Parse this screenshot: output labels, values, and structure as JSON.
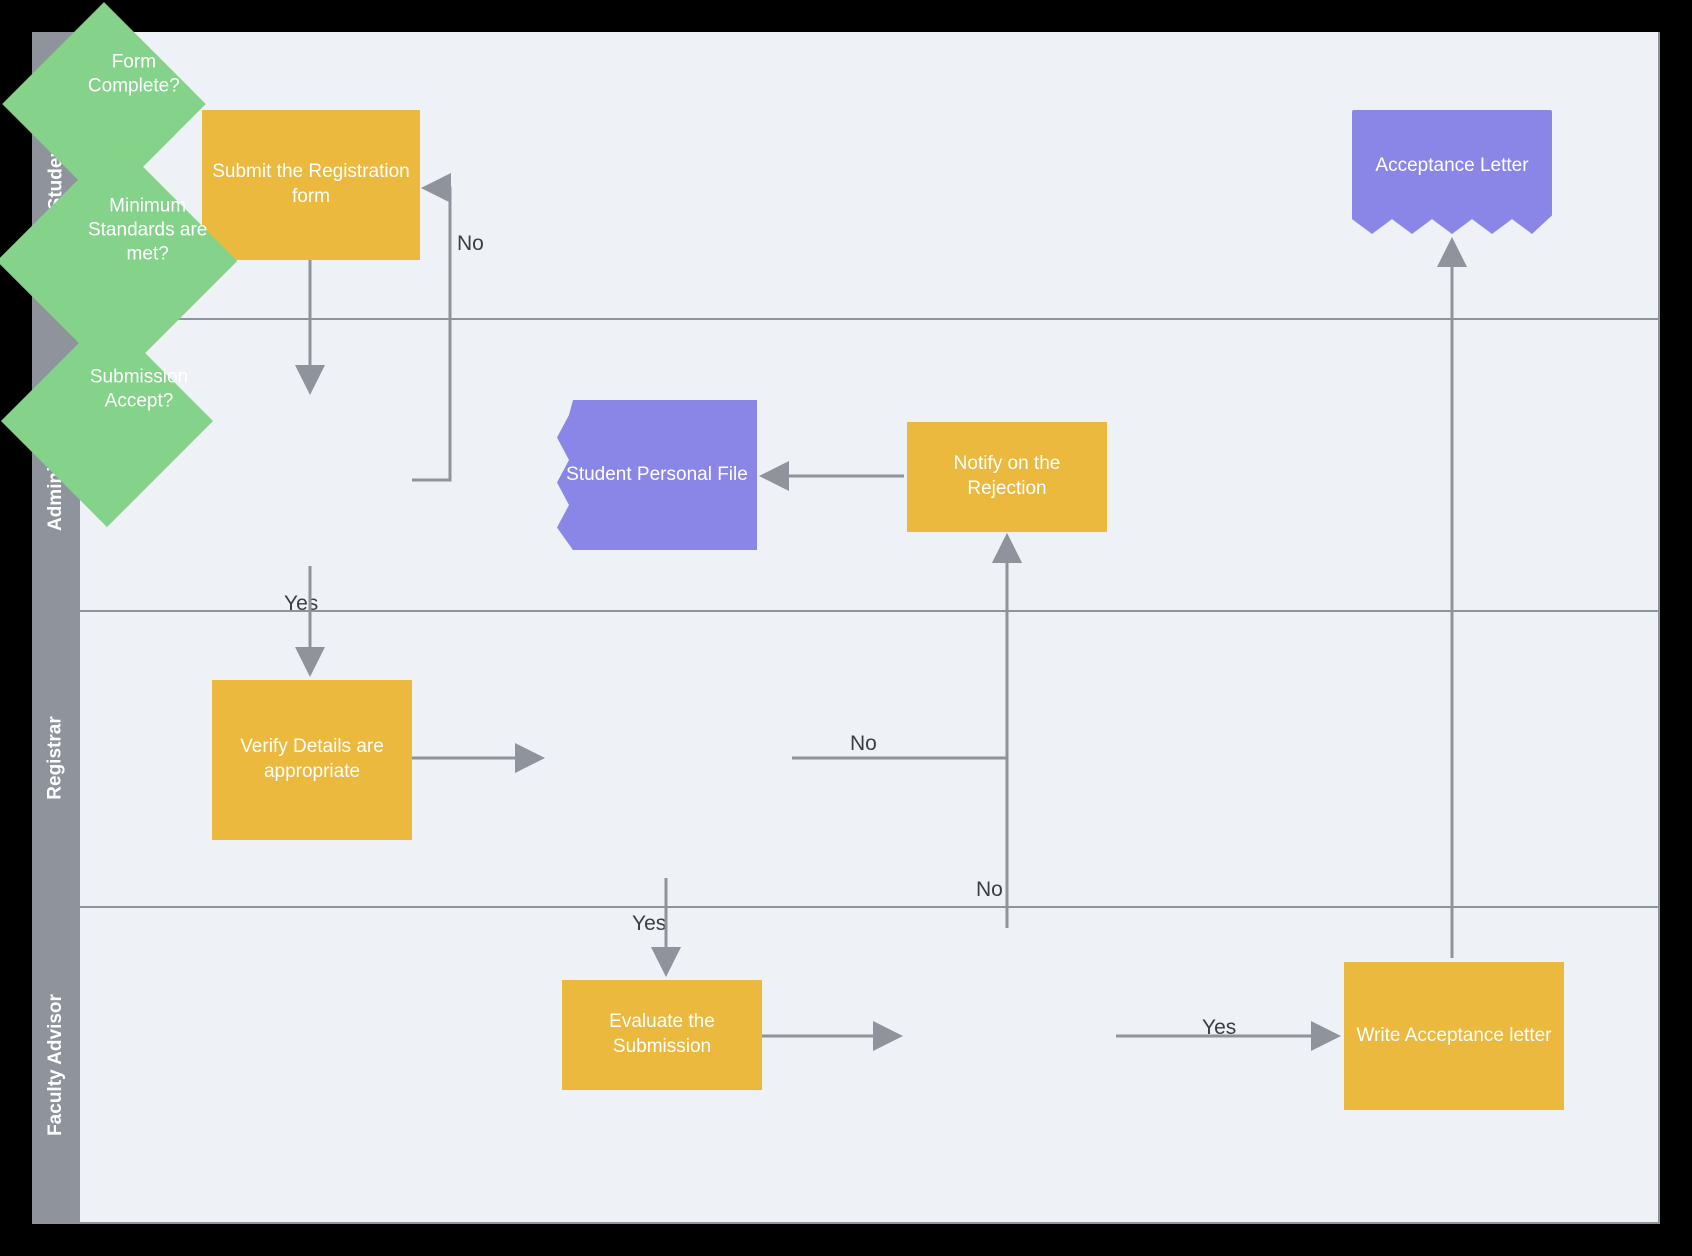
{
  "lanes": {
    "student": "Student",
    "administration": "Administration",
    "registrar": "Registrar",
    "faculty": "Faculty Advisor"
  },
  "nodes": {
    "submit": "Submit the Registration form",
    "form_complete": "Form Complete?",
    "verify": "Verify Details are appropriate",
    "min_standards": "Minimum Standards  are met?",
    "notify_reject": "Notify on the Rejection",
    "student_file": "Student Personal File",
    "evaluate": "Evaluate the Submission",
    "submission_accept": "Submission Accept?",
    "write_letter": "Write Acceptance letter",
    "acceptance_letter": "Acceptance Letter"
  },
  "edge_labels": {
    "no1": "No",
    "yes1": "Yes",
    "no2": "No",
    "yes2": "Yes",
    "no3": "No",
    "yes3": "Yes"
  },
  "colors": {
    "process": "#eab93d",
    "decision": "#85d28a",
    "document": "#8a86e8",
    "lane_header": "#8e939c",
    "canvas": "#eef1f6"
  }
}
